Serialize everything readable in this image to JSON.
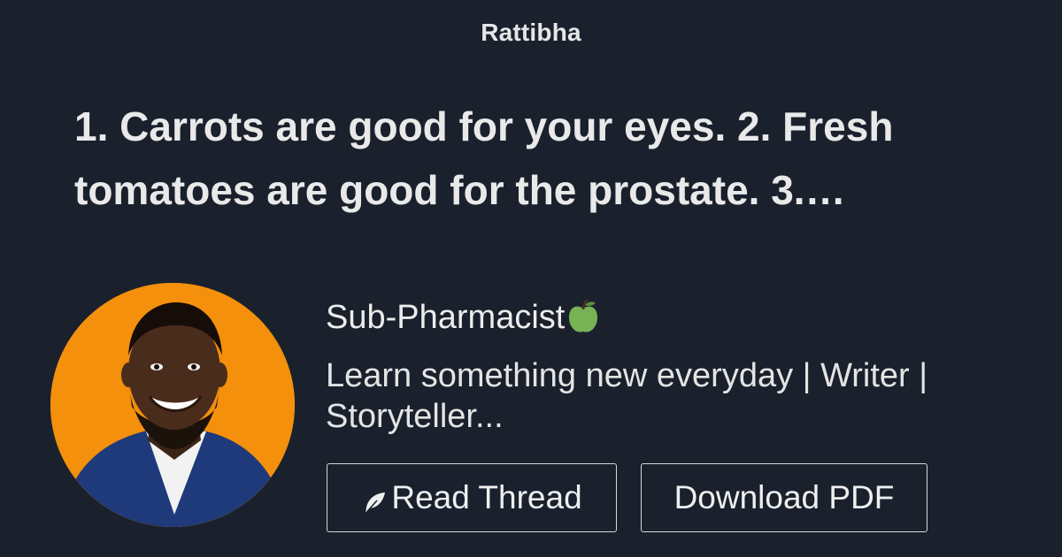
{
  "brand": {
    "name": "Rattibha"
  },
  "thread": {
    "headline": "1. Carrots are good for your eyes. 2. Fresh tomatoes are good for the prostate. 3.…"
  },
  "author": {
    "name": "Sub-Pharmacist",
    "name_icon": "green-apple-icon",
    "bio": "Learn something new everyday | Writer | Storyteller..."
  },
  "actions": {
    "read_thread_label": "Read Thread",
    "read_thread_icon": "feather-icon",
    "download_pdf_label": "Download PDF"
  },
  "colors": {
    "background": "#1a212d",
    "text": "#e6e6e6",
    "avatar_background": "#f4900c",
    "button_border": "#d6d6d6"
  }
}
